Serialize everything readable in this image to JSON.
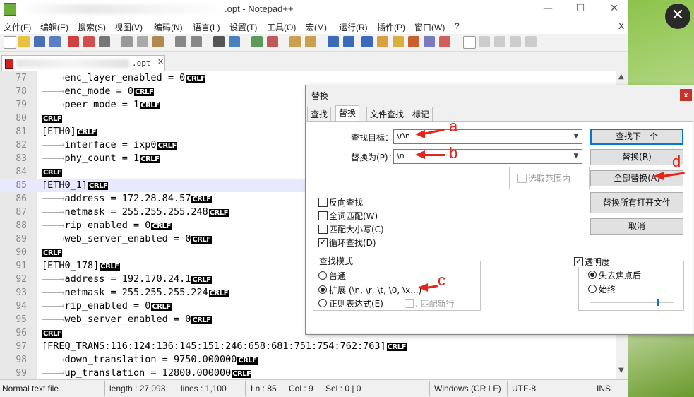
{
  "window": {
    "title_suffix": ".opt - Notepad++",
    "controls": [
      "—",
      "☐",
      "✕"
    ],
    "menubar_close": "X"
  },
  "menu": [
    "文件(F)",
    "编辑(E)",
    "搜索(S)",
    "视图(V)",
    "编码(N)",
    "语言(L)",
    "设置(T)",
    "工具(O)",
    "宏(M)",
    "运行(R)",
    "插件(P)",
    "窗口(W)",
    "?"
  ],
  "tab": {
    "name": ".opt",
    "close": "✕"
  },
  "editor": {
    "lines": [
      {
        "n": "77",
        "indent": true,
        "text": "enc_layer_enabled = 0",
        "crlf": "CRLF"
      },
      {
        "n": "78",
        "indent": true,
        "text": "enc_mode = 0",
        "crlf": "CRLF"
      },
      {
        "n": "79",
        "indent": true,
        "text": "peer_mode = 1",
        "crlf": "CRLF"
      },
      {
        "n": "80",
        "indent": false,
        "text": "",
        "crlf": "CRLF"
      },
      {
        "n": "81",
        "indent": false,
        "text": "[ETH0]",
        "crlf": "CRLF"
      },
      {
        "n": "82",
        "indent": true,
        "text": "interface = ixp0",
        "crlf": "CRLF"
      },
      {
        "n": "83",
        "indent": true,
        "text": "phy_count = 1",
        "crlf": "CRLF"
      },
      {
        "n": "84",
        "indent": false,
        "text": "",
        "crlf": "CRLF"
      },
      {
        "n": "85",
        "indent": false,
        "text": "[ETH0_1]",
        "crlf": "CRLF",
        "current": true
      },
      {
        "n": "86",
        "indent": true,
        "text": "address = 172.28.84.57",
        "crlf": "CRLF"
      },
      {
        "n": "87",
        "indent": true,
        "text": "netmask = 255.255.255.248",
        "crlf": "CRLF"
      },
      {
        "n": "88",
        "indent": true,
        "text": "rip_enabled = 0",
        "crlf": "CRLF"
      },
      {
        "n": "89",
        "indent": true,
        "text": "web_server_enabled = 0",
        "crlf": "CRLF"
      },
      {
        "n": "90",
        "indent": false,
        "text": "",
        "crlf": "CRLF"
      },
      {
        "n": "91",
        "indent": false,
        "text": "[ETH0_178]",
        "crlf": "CRLF"
      },
      {
        "n": "92",
        "indent": true,
        "text": "address = 192.170.24.1",
        "crlf": "CRLF"
      },
      {
        "n": "93",
        "indent": true,
        "text": "netmask = 255.255.255.224",
        "crlf": "CRLF"
      },
      {
        "n": "94",
        "indent": true,
        "text": "rip_enabled = 0",
        "crlf": "CRLF"
      },
      {
        "n": "95",
        "indent": true,
        "text": "web_server_enabled = 0",
        "crlf": "CRLF"
      },
      {
        "n": "96",
        "indent": false,
        "text": "",
        "crlf": "CRLF"
      },
      {
        "n": "97",
        "indent": false,
        "text": "[FREQ_TRANS:116:124:136:145:151:246:658:681:751:754:762:763]",
        "crlf": "CRLF"
      },
      {
        "n": "98",
        "indent": true,
        "text": "down_translation = 9750.000000",
        "crlf": "CRLF"
      },
      {
        "n": "99",
        "indent": true,
        "text": "up_translation = 12800.000000",
        "crlf": "CRLF"
      }
    ]
  },
  "status": {
    "type": "Normal text file",
    "length": "length : 27,093",
    "lines": "lines : 1,100",
    "ln": "Ln : 85",
    "col": "Col : 9",
    "sel": "Sel : 0 | 0",
    "eol": "Windows (CR LF)",
    "encoding": "UTF-8",
    "mode": "INS"
  },
  "dialog": {
    "title": "替换",
    "close": "x",
    "tabs": [
      "查找",
      "替换",
      "文件查找",
      "标记"
    ],
    "find_label": "查找目标：",
    "find_value": "\\r\\n",
    "replace_label": "替换为(P)：",
    "replace_value": "\\n",
    "in_selection": "选取范围内",
    "buttons": {
      "find_next": "查找下一个",
      "replace": "替换(R)",
      "replace_all": "全部替换(A)",
      "replace_all_open": "替换所有打开文件",
      "cancel": "取消"
    },
    "options": [
      {
        "label": "反向查找",
        "checked": false
      },
      {
        "label": "全词匹配(W)",
        "checked": false
      },
      {
        "label": "匹配大小写(C)",
        "checked": false
      },
      {
        "label": "循环查找(D)",
        "checked": true
      }
    ],
    "search_mode": {
      "title": "查找模式",
      "normal": "普通",
      "extended": "扩展 (\\n, \\r, \\t, \\0, \\x...)",
      "regex": "正则表达式(E)",
      "dot_newline": ". 匹配新行",
      "selected": "extended"
    },
    "transparency": {
      "title": "透明度",
      "checked": true,
      "on_lose_focus": "失去焦点后",
      "always": "始终",
      "selected": "on_lose_focus",
      "level": 0.8
    }
  },
  "annotations": {
    "a": "a",
    "b": "b",
    "c": "c",
    "d": "d",
    "color": "#e8231c"
  }
}
